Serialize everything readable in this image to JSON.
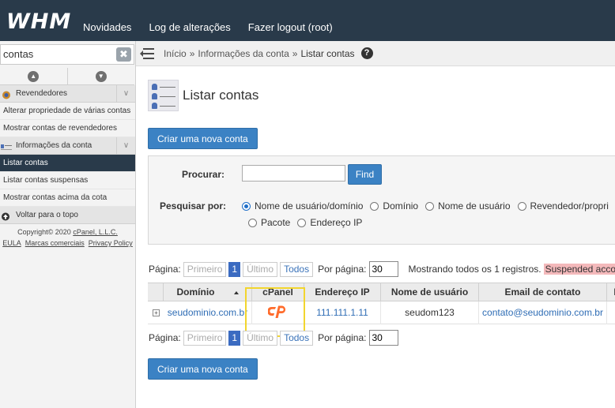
{
  "topbar": {
    "logo": "WHM",
    "nav": [
      "Novidades",
      "Log de alterações",
      "Fazer logout (root)"
    ]
  },
  "sidebar": {
    "search_value": "contas",
    "clear_label": "✖",
    "items": [
      {
        "kind": "category",
        "label": "Revendedores",
        "icon": "reseller-icon"
      },
      {
        "kind": "link",
        "label": "Alterar propriedade de várias contas"
      },
      {
        "kind": "link",
        "label": "Mostrar contas de revendedores"
      },
      {
        "kind": "category",
        "label": "Informações da conta",
        "icon": "account-info-icon"
      },
      {
        "kind": "link",
        "label": "Listar contas",
        "active": true
      },
      {
        "kind": "link",
        "label": "Listar contas suspensas"
      },
      {
        "kind": "link",
        "label": "Mostrar contas acima da cota"
      },
      {
        "kind": "category",
        "label": "Voltar para o topo",
        "icon": "back-to-top-icon"
      }
    ],
    "footer": {
      "copyright_prefix": "Copyright© 2020 ",
      "copyright_link": "cPanel, L.L.C.",
      "links": [
        "EULA",
        "Marcas comerciais",
        "Privacy Policy"
      ]
    }
  },
  "breadcrumb": {
    "items": [
      "Início",
      "Informações da conta",
      "Listar contas"
    ],
    "separator": "»"
  },
  "page": {
    "title": "Listar contas",
    "create_button": "Criar uma nova conta"
  },
  "search": {
    "label": "Procurar:",
    "value": "",
    "go_button": "Find",
    "by_label": "Pesquisar por:",
    "options": [
      {
        "label": "Nome de usuário/domínio",
        "selected": true
      },
      {
        "label": "Domínio",
        "selected": false
      },
      {
        "label": "Nome de usuário",
        "selected": false
      },
      {
        "label": "Revendedor/propri",
        "selected": false
      },
      {
        "label": "Pacote",
        "selected": false
      },
      {
        "label": "Endereço IP",
        "selected": false
      }
    ]
  },
  "pager": {
    "page_label": "Página:",
    "first": "Primeiro",
    "current": "1",
    "last": "Último",
    "all": "Todos",
    "per_page_label": "Por página:",
    "per_page_value": "30",
    "showing": "Mostrando todos os 1 registros.",
    "suspended": "Suspended account"
  },
  "table": {
    "headers": [
      "Domínio",
      "cPanel",
      "Endereço IP",
      "Nome de usuário",
      "Email de contato",
      "I"
    ],
    "rows": [
      {
        "expand": "+",
        "domain": "seudominio.com.br",
        "ip": "111.111.1.11",
        "username": "seudom123",
        "email": "contato@seudominio.com.br"
      }
    ]
  },
  "colors": {
    "topbar": "#293a4a",
    "button": "#3b82c4",
    "link": "#2f6db5",
    "highlight": "#f2d52e",
    "cpanel": "#ff6c2c"
  }
}
